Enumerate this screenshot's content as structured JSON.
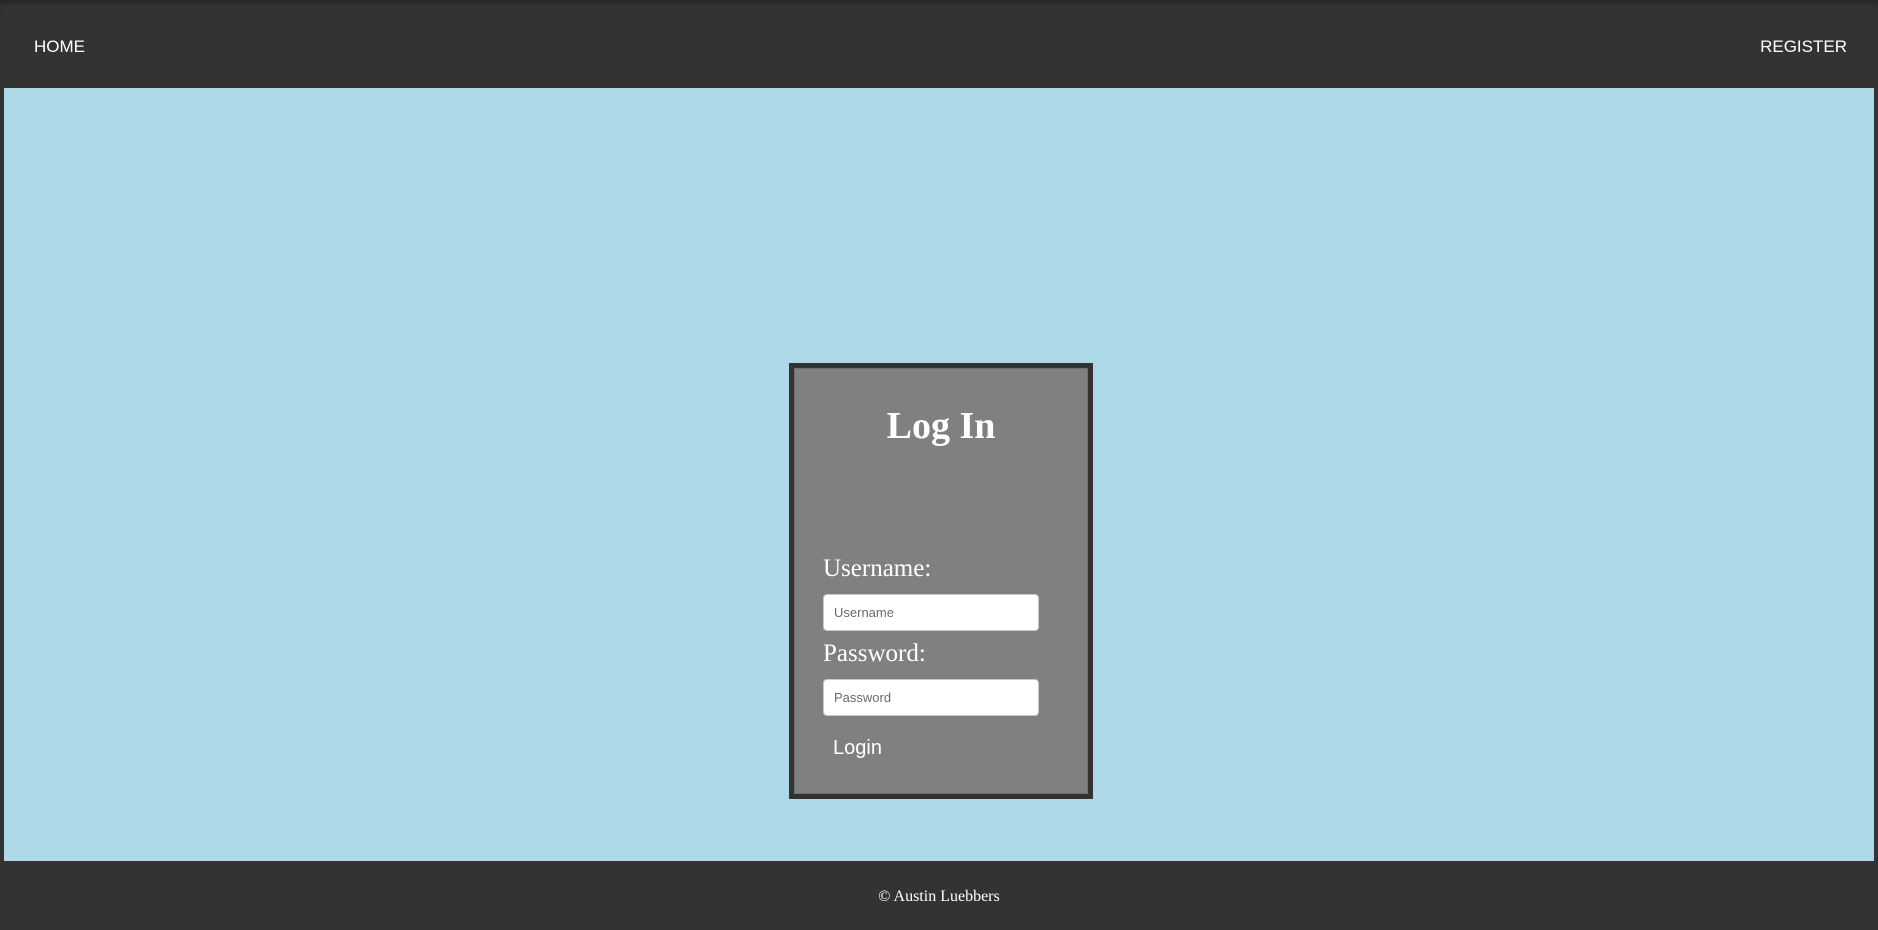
{
  "nav": {
    "home_label": "HOME",
    "register_label": "REGISTER"
  },
  "login": {
    "title": "Log In",
    "username_label": "Username:",
    "username_placeholder": "Username",
    "username_value": "",
    "password_label": "Password:",
    "password_placeholder": "Password",
    "password_value": "",
    "submit_label": "Login"
  },
  "footer": {
    "text": "© Austin Luebbers"
  },
  "colors": {
    "chrome": "#333333",
    "background": "#add8e6",
    "panel": "#808080",
    "text": "#ffffff"
  }
}
